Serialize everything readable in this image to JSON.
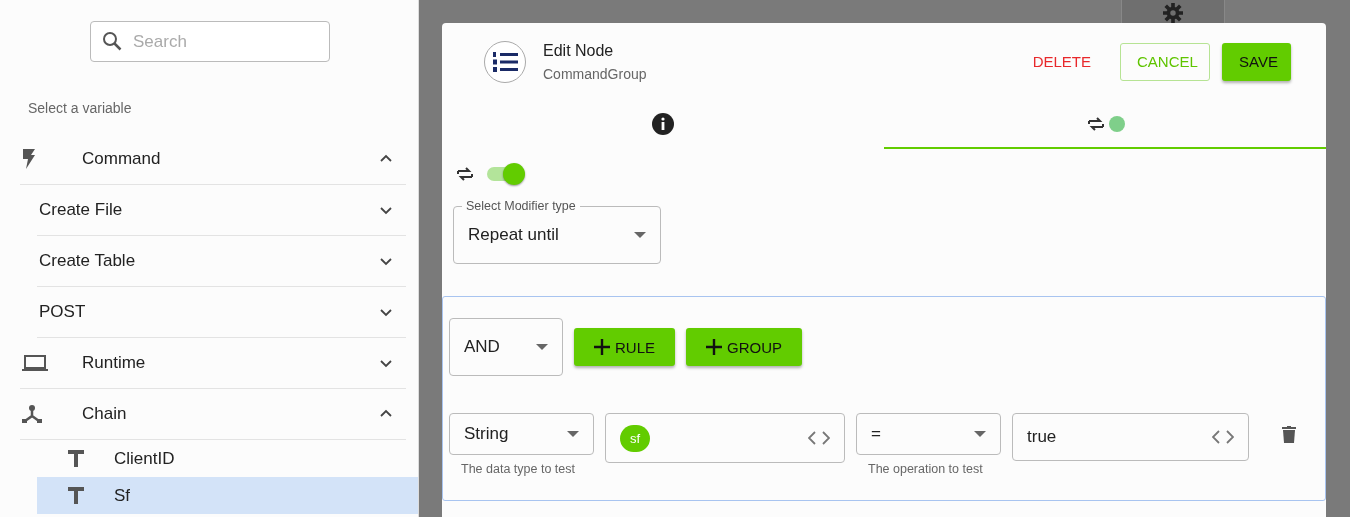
{
  "sidebar": {
    "search": {
      "placeholder": "Search"
    },
    "heading": "Select a variable",
    "items": [
      {
        "label": "Command",
        "kind": "bolt",
        "expanded": true,
        "children": [
          {
            "label": "Create File",
            "kind": "plain",
            "expanded": false
          },
          {
            "label": "Create Table",
            "kind": "plain",
            "expanded": false
          },
          {
            "label": "POST",
            "kind": "plain",
            "expanded": false
          }
        ]
      },
      {
        "label": "Runtime",
        "kind": "laptop",
        "expanded": false
      },
      {
        "label": "Chain",
        "kind": "chain",
        "expanded": true,
        "children": [
          {
            "label": "ClientID",
            "kind": "text",
            "selected": false
          },
          {
            "label": "Sf",
            "kind": "text",
            "selected": true
          }
        ]
      }
    ]
  },
  "dialog": {
    "title": "Edit Node",
    "subtitle": "CommandGroup",
    "buttons": [
      {
        "label": "DELETE",
        "kind": "text"
      },
      {
        "label": "CANCEL",
        "kind": "outlined"
      },
      {
        "label": "SAVE",
        "kind": "filled"
      }
    ],
    "tabs": [
      {
        "kind": "info",
        "selected": false
      },
      {
        "kind": "modifier",
        "selected": true
      }
    ],
    "modifier": {
      "on": true,
      "select": {
        "label": "Select Modifier type",
        "value": "Repeat until"
      }
    },
    "rule_group": {
      "combinator": "AND",
      "buttons": [
        "RULE",
        "GROUP"
      ],
      "rule": {
        "type": {
          "value": "String",
          "helper": "The data type to test"
        },
        "field": {
          "chip": "sf"
        },
        "operator": {
          "value": "=",
          "helper": "The operation to test"
        },
        "value": "true"
      }
    }
  }
}
